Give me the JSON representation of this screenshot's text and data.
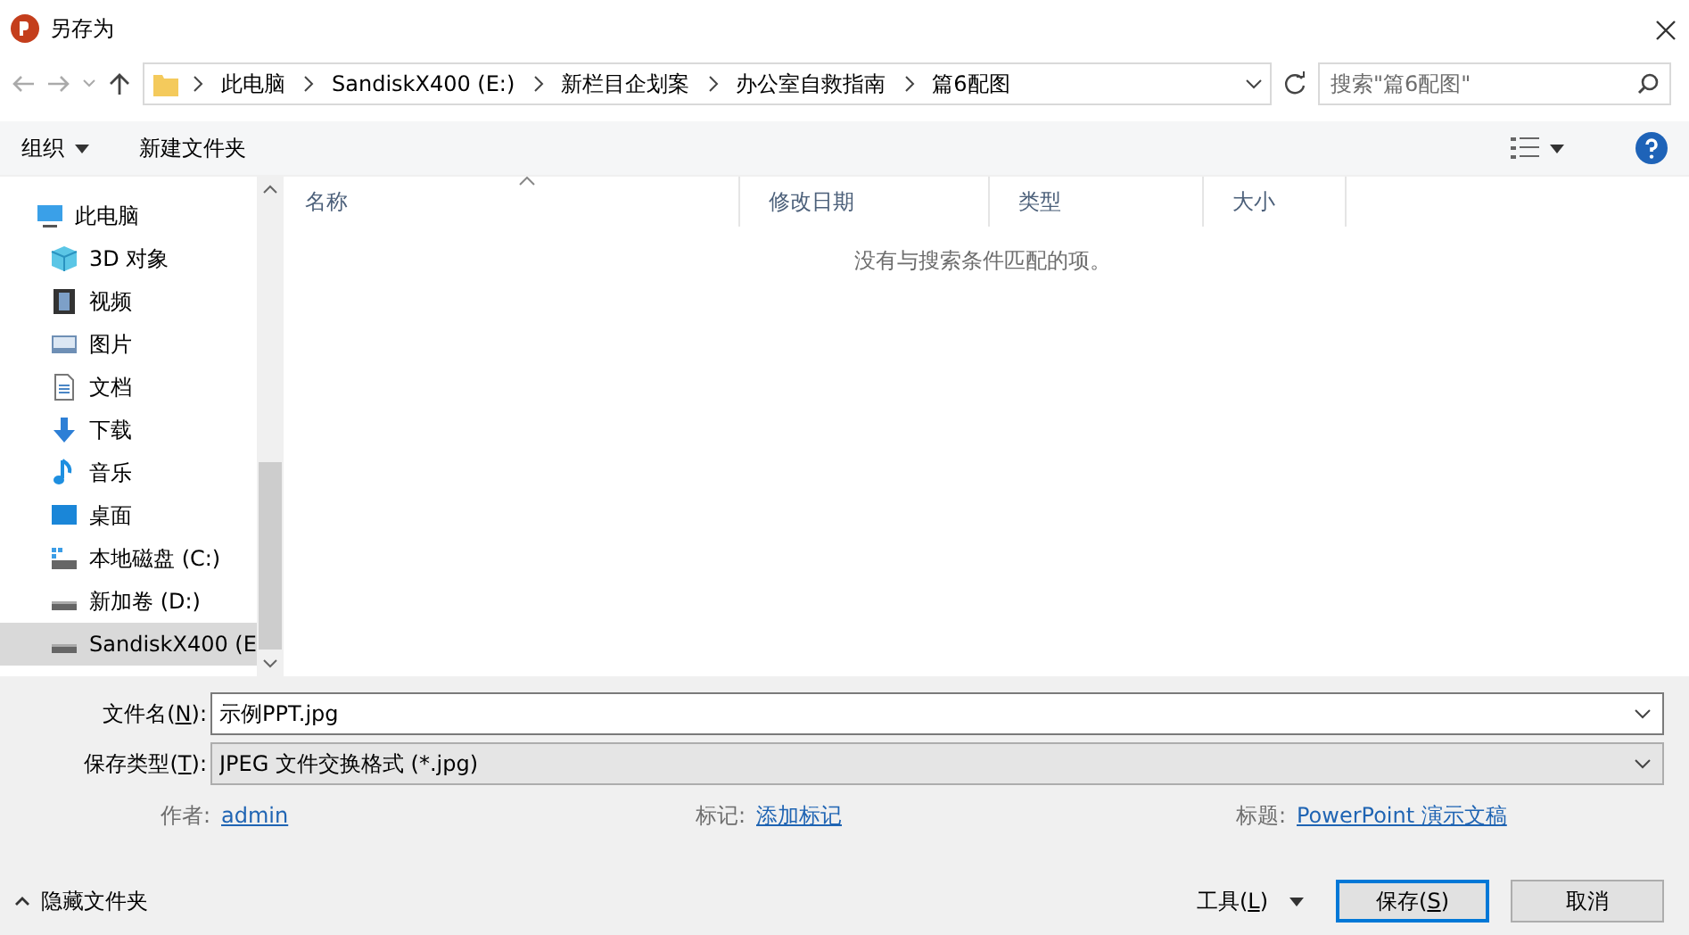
{
  "window": {
    "title": "另存为"
  },
  "address": {
    "crumbs": [
      "此电脑",
      "SandiskX400 (E:)",
      "新栏目企划案",
      "办公室自救指南",
      "篇6配图"
    ],
    "search_placeholder": "搜索\"篇6配图\""
  },
  "toolbar": {
    "organize": "组织",
    "new_folder": "新建文件夹"
  },
  "sidebar": {
    "items": [
      {
        "label": "此电脑",
        "kind": "pc",
        "selected": false,
        "children": [
          {
            "label": "3D 对象",
            "kind": "cube",
            "selected": false
          },
          {
            "label": "视频",
            "kind": "film",
            "selected": false
          },
          {
            "label": "图片",
            "kind": "image",
            "selected": false
          },
          {
            "label": "文档",
            "kind": "doc",
            "selected": false
          },
          {
            "label": "下载",
            "kind": "download",
            "selected": false
          },
          {
            "label": "音乐",
            "kind": "music",
            "selected": false
          },
          {
            "label": "桌面",
            "kind": "desktop",
            "selected": false
          },
          {
            "label": "本地磁盘 (C:)",
            "kind": "system-drive",
            "selected": false
          },
          {
            "label": "新加卷 (D:)",
            "kind": "drive",
            "selected": false
          },
          {
            "label": "SandiskX400 (E",
            "kind": "drive",
            "selected": true
          }
        ]
      }
    ]
  },
  "table": {
    "columns": [
      "名称",
      "修改日期",
      "类型",
      "大小"
    ],
    "empty_message": "没有与搜索条件匹配的项。"
  },
  "fields": [
    {
      "label": [
        "文件名(",
        "N",
        "):"
      ],
      "value": "示例PPT.jpg",
      "kind": "input"
    },
    {
      "label": [
        "保存类型(",
        "T",
        "):"
      ],
      "value": "JPEG 文件交换格式 (*.jpg)",
      "kind": "select"
    }
  ],
  "meta": [
    {
      "label": "作者:",
      "value": "admin"
    },
    {
      "label": "标记:",
      "value": "添加标记"
    },
    {
      "label": "标题:",
      "value": "PowerPoint 演示文稿"
    }
  ],
  "footer": {
    "hide_folders": "隐藏文件夹",
    "tools": [
      "工具(",
      "L",
      ")"
    ],
    "save": [
      "保存(",
      "S",
      ")"
    ],
    "cancel": "取消"
  }
}
